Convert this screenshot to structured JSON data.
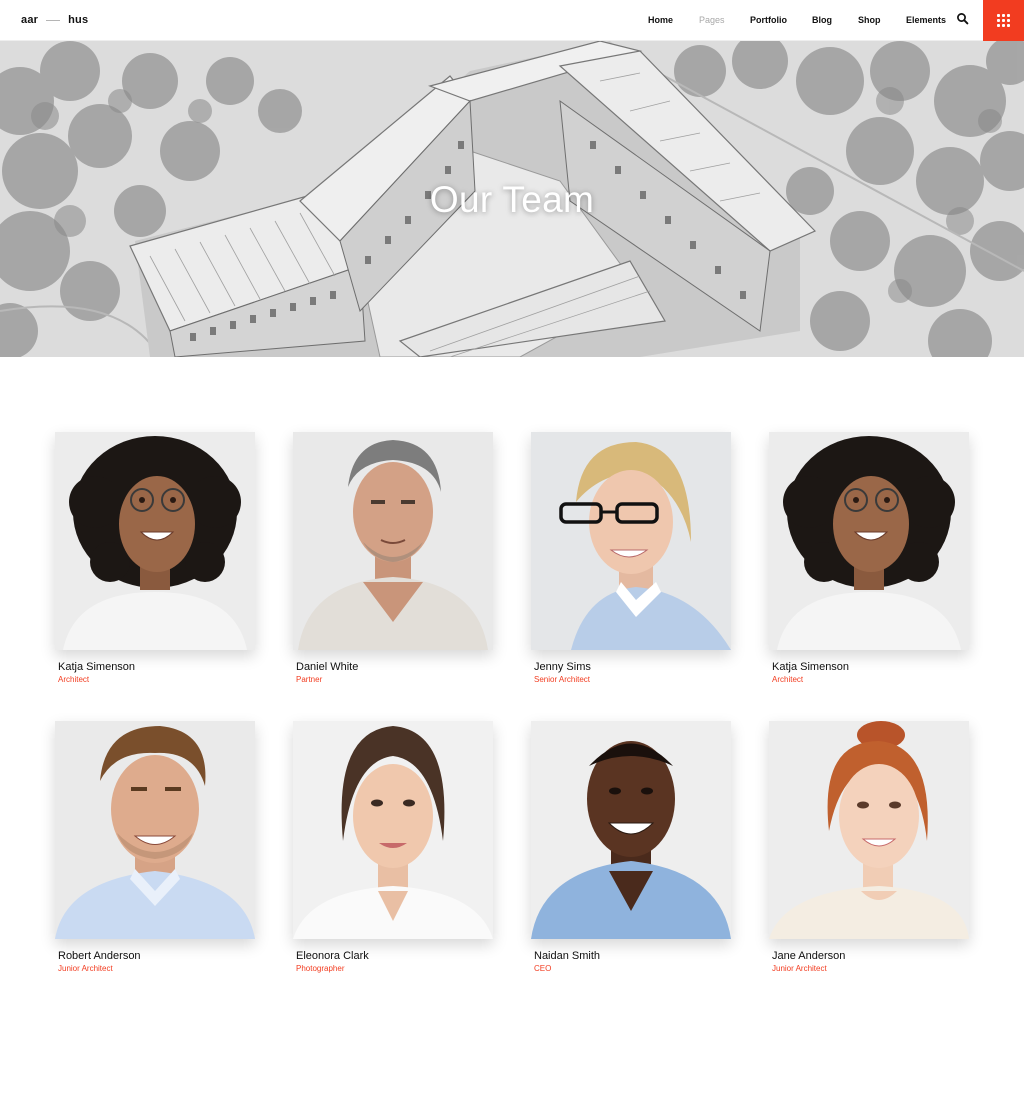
{
  "header": {
    "logo_left": "aar",
    "logo_right": "hus",
    "nav": [
      {
        "label": "Home"
      },
      {
        "label": "Pages"
      },
      {
        "label": "Portfolio"
      },
      {
        "label": "Blog"
      },
      {
        "label": "Shop"
      },
      {
        "label": "Elements"
      }
    ],
    "active_index": 1
  },
  "hero": {
    "title": "Our Team"
  },
  "team": [
    {
      "name": "Katja Simenson",
      "role": "Architect"
    },
    {
      "name": "Daniel White",
      "role": "Partner"
    },
    {
      "name": "Jenny Sims",
      "role": "Senior Architect"
    },
    {
      "name": "Katja Simenson",
      "role": "Architect"
    },
    {
      "name": "Robert Anderson",
      "role": "Junior Architect"
    },
    {
      "name": "Eleonora Clark",
      "role": "Photographer"
    },
    {
      "name": "Naidan Smith",
      "role": "CEO"
    },
    {
      "name": "Jane Anderson",
      "role": "Junior Architect"
    }
  ],
  "colors": {
    "accent": "#f23c20",
    "muted_nav": "#a8a8a8",
    "text": "#111111"
  },
  "icons": {
    "search": "search-icon",
    "menu": "grid-menu-icon"
  }
}
